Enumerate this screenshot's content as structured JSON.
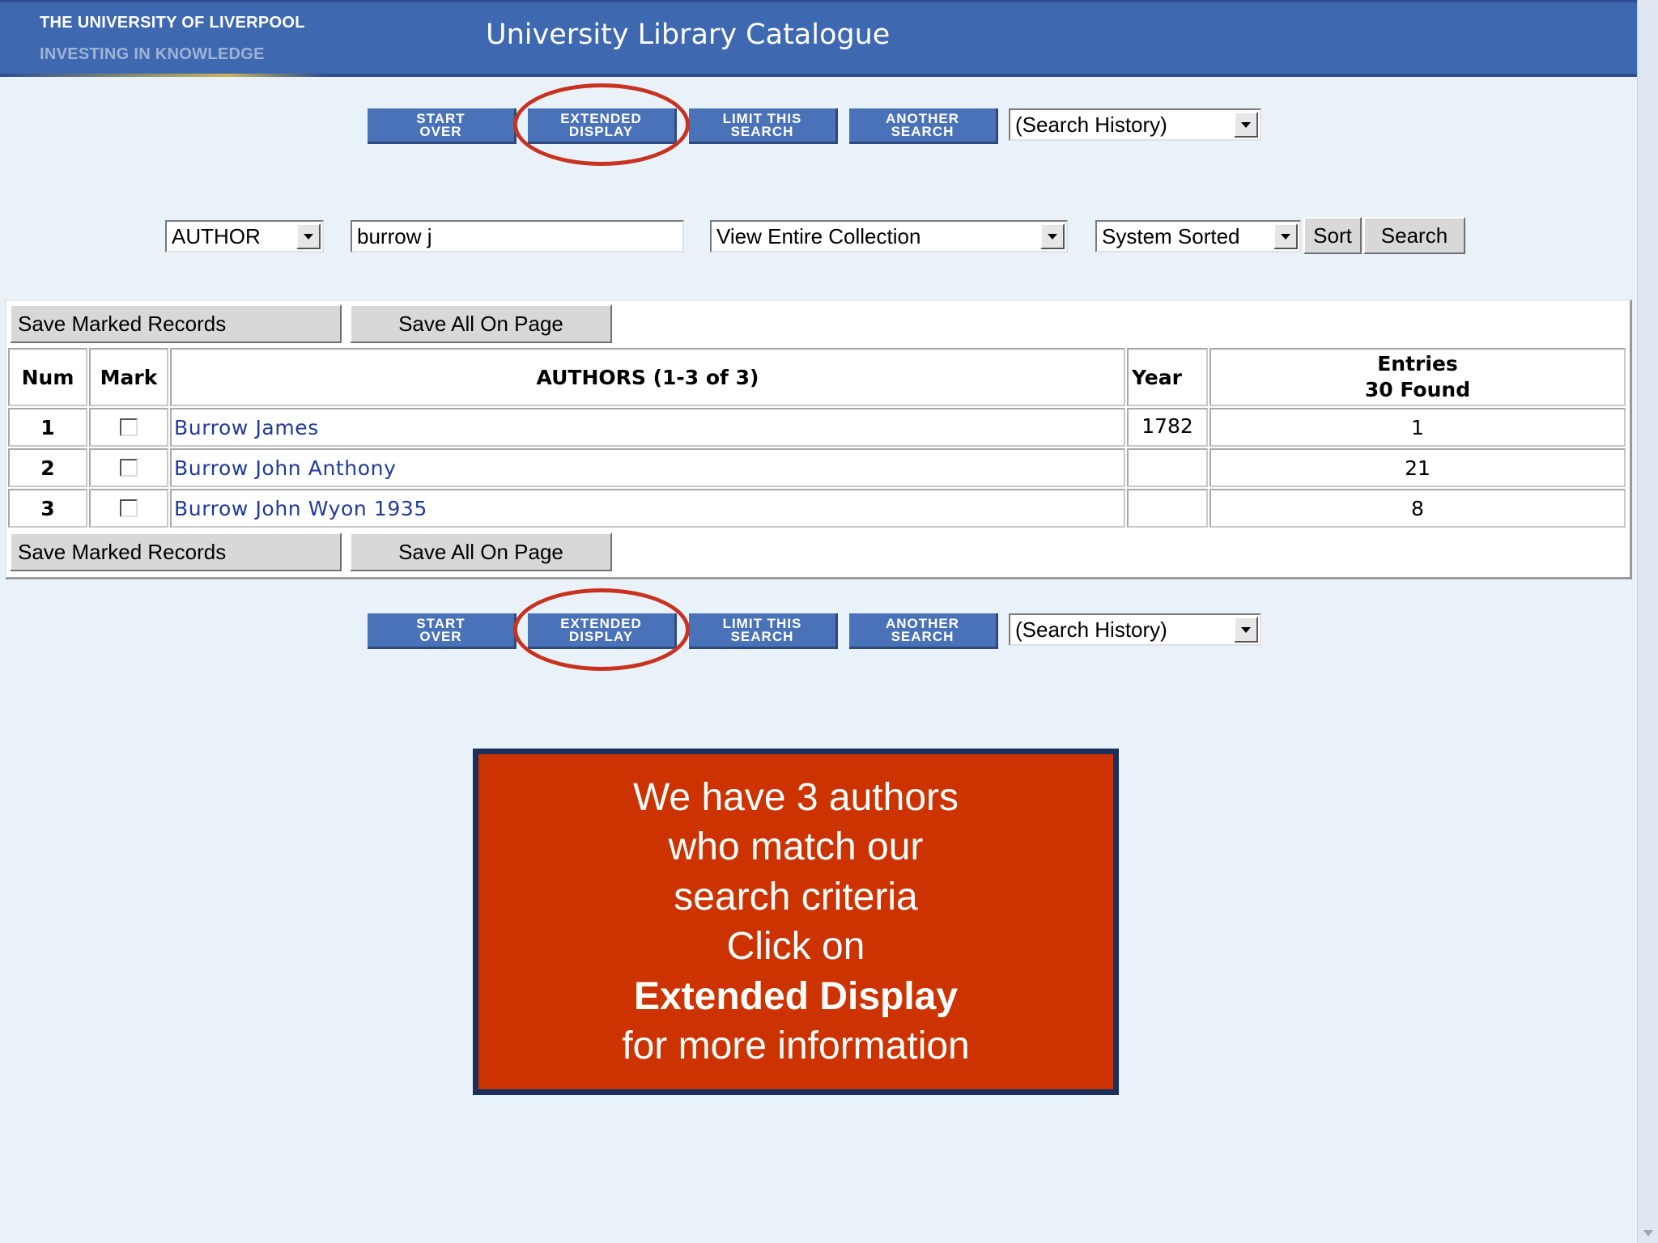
{
  "header": {
    "university": "THE UNIVERSITY OF LIVERPOOL",
    "tagline": "INVESTING IN KNOWLEDGE",
    "title": "University Library Catalogue"
  },
  "nav": {
    "start_over": "Start\nOver",
    "extended_display": "Extended\nDisplay",
    "limit_search": "Limit This\nSearch",
    "another_search": "Another\nSearch",
    "search_history": "(Search History)"
  },
  "search": {
    "field": "AUTHOR",
    "query": "burrow j",
    "collection": "View Entire Collection",
    "sort_order": "System Sorted",
    "sort_label": "Sort",
    "search_label": "Search"
  },
  "results": {
    "save_marked": "Save Marked Records",
    "save_all": "Save All On Page",
    "headers": {
      "num": "Num",
      "mark": "Mark",
      "authors": "AUTHORS (1-3 of 3)",
      "year": "Year",
      "entries_line1": "Entries",
      "entries_line2": "30 Found"
    },
    "rows": [
      {
        "num": "1",
        "author": "Burrow James",
        "year": "1782",
        "entries": "1"
      },
      {
        "num": "2",
        "author": "Burrow John Anthony",
        "year": "",
        "entries": "21"
      },
      {
        "num": "3",
        "author": "Burrow John Wyon 1935",
        "year": "",
        "entries": "8"
      }
    ]
  },
  "callout": {
    "line1": "We have 3 authors",
    "line2": "who match our",
    "line3": "search criteria",
    "line4": "Click on",
    "line5": "Extended Display",
    "line6": "for more information"
  },
  "colors": {
    "header_bg": "#3e68b0",
    "nav_button": "#4a72b8",
    "highlight_ring": "#c8321f",
    "callout_bg": "#cc3300",
    "callout_border": "#1b2f5a",
    "page_bg": "#eaf2f9",
    "link": "#1f3a9a"
  }
}
